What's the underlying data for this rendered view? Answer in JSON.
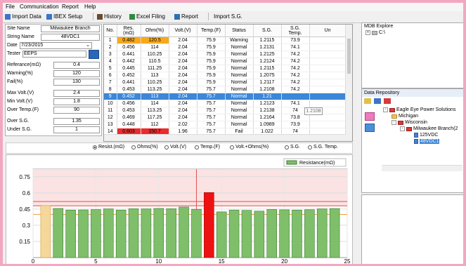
{
  "menu": [
    "File",
    "Communication",
    "Report",
    "Help"
  ],
  "toolbar": {
    "import_data": "Import Data",
    "ibex_setup": "IBEX Setup",
    "history": "History",
    "excel_filing": "Excel Filing",
    "report": "Report",
    "import_sg": "Import S.G."
  },
  "form": {
    "site_name_label": "Site Name",
    "site_name": "Milwaukee Branch",
    "string_name_label": "String Name",
    "string_name": "48VDC1",
    "date_label": "Date",
    "date": "7/23/2015",
    "tester_label": "Tester",
    "tester": "EEPS",
    "reference_label": "Referance(mΩ)",
    "reference": "0.4",
    "warning_label": "Warning(%)",
    "warning": "120",
    "fail_label": "Fail(%)",
    "fail": "130",
    "max_volt_label": "Max Volt.(V)",
    "max_volt": "2.4",
    "min_volt_label": "Min Volt.(V)",
    "min_volt": "1.8",
    "over_temp_label": "Over Temp.(F)",
    "over_temp": "90",
    "over_sg_label": "Over S.G.",
    "over_sg": "1.35",
    "under_sg_label": "Under S.G.",
    "under_sg": "1"
  },
  "table": {
    "headers": [
      "No.",
      "Res.\n(mΩ)",
      "Ohm(%)",
      "Volt.(V)",
      "Temp.(F)",
      "Status",
      "S.G.",
      "S.G.\nTemp.",
      "Un"
    ],
    "rows": [
      [
        "1",
        "0.482",
        "120.5",
        "2.04",
        "75.9",
        "Warning",
        "1.2115",
        "73.9",
        ""
      ],
      [
        "2",
        "0.456",
        "114",
        "2.04",
        "75.9",
        "Normal",
        "1.2131",
        "74.1",
        ""
      ],
      [
        "3",
        "0.441",
        "110.25",
        "2.04",
        "75.9",
        "Normal",
        "1.2125",
        "74.2",
        ""
      ],
      [
        "4",
        "0.442",
        "110.5",
        "2.04",
        "75.9",
        "Normal",
        "1.2124",
        "74.2",
        ""
      ],
      [
        "5",
        "0.445",
        "111.25",
        "2.04",
        "75.9",
        "Normal",
        "1.2115",
        "74.2",
        ""
      ],
      [
        "6",
        "0.452",
        "113",
        "2.04",
        "75.9",
        "Normal",
        "1.2075",
        "74.2",
        ""
      ],
      [
        "7",
        "0.441",
        "110.25",
        "2.04",
        "75.9",
        "Normal",
        "1.2117",
        "74.2",
        ""
      ],
      [
        "8",
        "0.453",
        "113.25",
        "2.04",
        "75.7",
        "Normal",
        "1.2108",
        "74.2",
        ""
      ],
      [
        "9",
        "0.452",
        "113",
        "2.04",
        "75.7",
        "Normal",
        "1.21",
        "",
        ""
      ],
      [
        "10",
        "0.456",
        "114",
        "2.04",
        "75.7",
        "Normal",
        "1.2123",
        "74.1",
        ""
      ],
      [
        "11",
        "0.453",
        "113.25",
        "2.04",
        "75.7",
        "Normal",
        "1.2138",
        "74",
        ""
      ],
      [
        "12",
        "0.469",
        "117.25",
        "2.04",
        "75.7",
        "Normal",
        "1.2164",
        "73.8",
        ""
      ],
      [
        "13",
        "0.448",
        "112",
        "2.02",
        "75.7",
        "Normal",
        "1.0989",
        "73.9",
        ""
      ],
      [
        "14",
        "0.603",
        "150.7",
        "1.96",
        "75.7",
        "Fail",
        "1.022",
        "74",
        ""
      ],
      [
        "15",
        "0.424",
        "106",
        "2.04",
        "75.9",
        "Normal",
        "1.209",
        "74.1",
        ""
      ]
    ],
    "tooltip": "1.2108"
  },
  "radios": {
    "options": [
      "Resist.(mΩ)",
      "Ohms(%)",
      "Volt.(V)",
      "Temp.(F)",
      "Volt.+Ohms(%)",
      "S.G.",
      "S.G. Temp."
    ],
    "selected": "Resist.(mΩ)"
  },
  "mdb": {
    "title": "MDB Explore",
    "root": "C:\\"
  },
  "repository": {
    "title": "Data Repository",
    "tree": [
      "Eagle Eye Power Solutions",
      "Michigan",
      "Wisconsin",
      "Milwaukee Branch(2",
      "125VDC",
      "48VDC1"
    ]
  },
  "colors": {
    "bar_normal": "#7fbf6a",
    "bar_warning": "#f6d79a",
    "bar_fail": "#ee1111",
    "selected_row": "#3c87d8"
  },
  "chart_data": {
    "type": "bar",
    "legend": "Resistance(mΩ)",
    "legend_position": "top-right",
    "x": [
      1,
      2,
      3,
      4,
      5,
      6,
      7,
      8,
      9,
      10,
      11,
      12,
      13,
      14,
      15,
      16,
      17,
      18,
      19,
      20,
      21,
      22,
      23,
      24
    ],
    "values": [
      0.482,
      0.456,
      0.441,
      0.442,
      0.445,
      0.452,
      0.441,
      0.453,
      0.452,
      0.456,
      0.453,
      0.469,
      0.448,
      0.603,
      0.424,
      0.441,
      0.438,
      0.431,
      0.446,
      0.443,
      0.441,
      0.444,
      0.452,
      0.455
    ],
    "status": [
      "warning",
      "normal",
      "normal",
      "normal",
      "normal",
      "normal",
      "normal",
      "normal",
      "normal",
      "normal",
      "normal",
      "normal",
      "normal",
      "fail",
      "normal",
      "normal",
      "normal",
      "normal",
      "normal",
      "normal",
      "normal",
      "normal",
      "normal",
      "normal"
    ],
    "xticks": [
      0,
      5,
      10,
      15,
      20,
      25
    ],
    "yticks": [
      0.15,
      0.3,
      0.45,
      0.6,
      0.75
    ],
    "ylim": [
      0,
      0.82
    ],
    "xlim": [
      0,
      25
    ],
    "thresholds": {
      "reference": 0.4,
      "warning": 0.48,
      "fail": 0.52
    },
    "marker_x": 13
  }
}
